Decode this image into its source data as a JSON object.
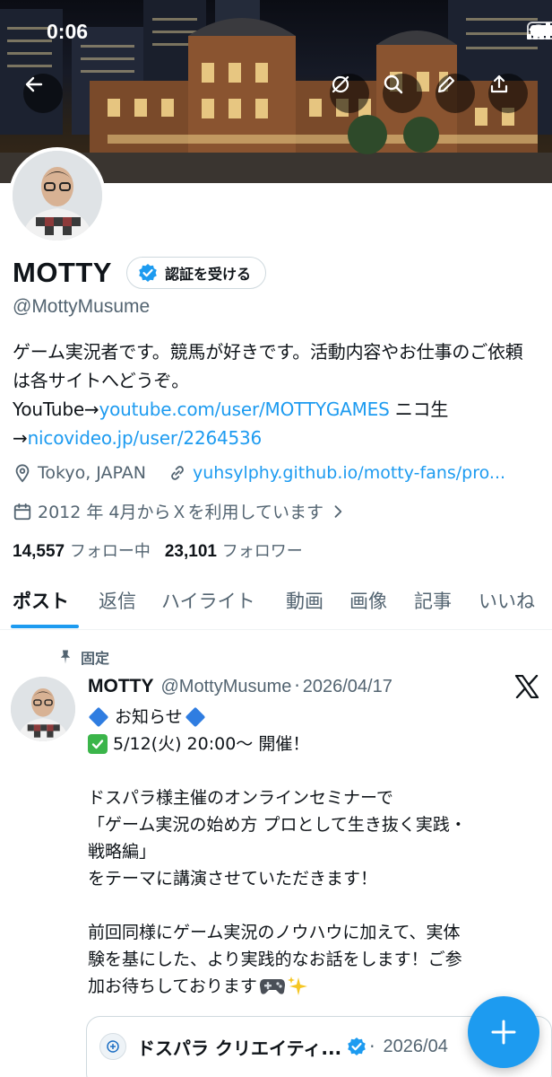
{
  "status_bar": {
    "time": "0:06"
  },
  "profile": {
    "display_name": "MOTTY",
    "verify_label": "認証を受ける",
    "handle": "@MottyMusume",
    "bio_text": "ゲーム実況者です。競馬が好きです。活動内容やお仕事のご依頼は各サイトへどうぞ。YouTube→",
    "bio_link1": "youtube.com/user/MOTTYGAMES",
    "bio_mid": " ニコ生 →",
    "bio_link2": "nicovideo.jp/user/2264536",
    "location": "Tokyo, JAPAN",
    "website": "yuhsylphy.github.io/motty-fans/pro...",
    "joined": "2012 年 4月からＸを利用しています",
    "following_count": "14,557",
    "following_label": "フォロー中",
    "followers_count": "23,101",
    "followers_label": "フォロワー"
  },
  "tabs": [
    {
      "label": "ポスト",
      "active": true
    },
    {
      "label": "返信"
    },
    {
      "label": "ハイライト"
    },
    {
      "label": "動画"
    },
    {
      "label": "画像"
    },
    {
      "label": "記事"
    },
    {
      "label": "いいね"
    }
  ],
  "post": {
    "pinned_label": "固定",
    "author": "MOTTY",
    "handle": "@MottyMusume",
    "separator": "·",
    "date": "2026/04/17",
    "line1": "お知らせ",
    "line2": "5/12(火) 20:00～ 開催！",
    "line3": "ドスパラ様主催のオンラインセミナーで",
    "line4": "「ゲーム実況の始め方 プロとして生き抜く実践・",
    "line5": "戦略編」",
    "line6": "をテーマに講演させていただきます！",
    "line7": "前回同様にゲーム実況のノウハウに加えて、実体",
    "line8": "験を基にした、より実践的なお話をします！ご参",
    "line9": "加お待ちしております",
    "quote_name": "ドスパラ クリエイティ...",
    "quote_date": "2026/04"
  },
  "colors": {
    "accent": "#1d9bf0",
    "text": "#0f1419",
    "muted": "#536471",
    "border": "#cfd9de"
  },
  "icons": [
    "back-arrow-icon",
    "grok-icon",
    "search-icon",
    "edit-icon",
    "share-icon",
    "verified-badge-icon",
    "location-pin-icon",
    "link-icon",
    "calendar-icon",
    "chevron-right-icon",
    "pin-icon",
    "x-logo-icon",
    "plus-icon",
    "gamepad-emoji",
    "sparkles-emoji"
  ]
}
